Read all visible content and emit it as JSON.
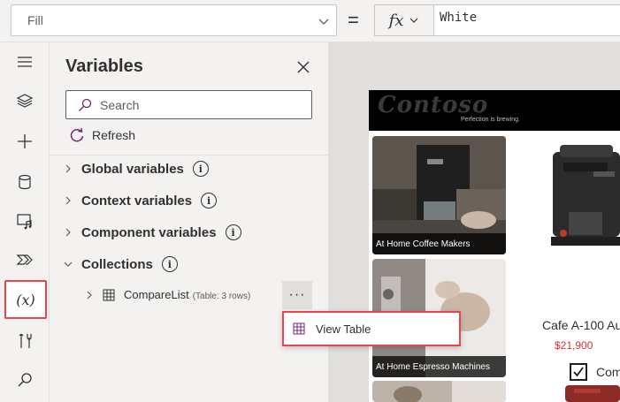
{
  "formula_bar": {
    "property": "Fill",
    "equals": "=",
    "fx": "fx",
    "formula": "White"
  },
  "rail": {
    "icons": [
      "hamburger-menu-icon",
      "layers-icon",
      "plus-icon",
      "database-icon",
      "media-icon",
      "power-automate-icon",
      "variables-icon",
      "tools-icon",
      "search-icon"
    ],
    "variables_label": "(x)"
  },
  "panel": {
    "title": "Variables",
    "search_placeholder": "Search",
    "refresh_label": "Refresh",
    "sections": [
      {
        "label": "Global variables",
        "expanded": false
      },
      {
        "label": "Context variables",
        "expanded": false
      },
      {
        "label": "Component variables",
        "expanded": false
      },
      {
        "label": "Collections",
        "expanded": true
      }
    ],
    "collection_item": {
      "name": "CompareList",
      "meta": "(Table: 3 rows)",
      "more_label": "···"
    }
  },
  "context_menu": {
    "view_table_label": "View Table"
  },
  "canvas": {
    "logo": "Contoso",
    "tagline": "Perfection is brewing.",
    "tiles": [
      {
        "label": "At Home Coffee Makers"
      },
      {
        "label": "At Home Espresso Machines"
      }
    ],
    "product_name": "Cafe A-100 Au",
    "product_price": "$21,900",
    "compare_label": "Com",
    "compare_checked": true
  },
  "colors": {
    "highlight_red": "#e8434e",
    "accent_purple": "#742774",
    "price_red": "#d13438"
  }
}
